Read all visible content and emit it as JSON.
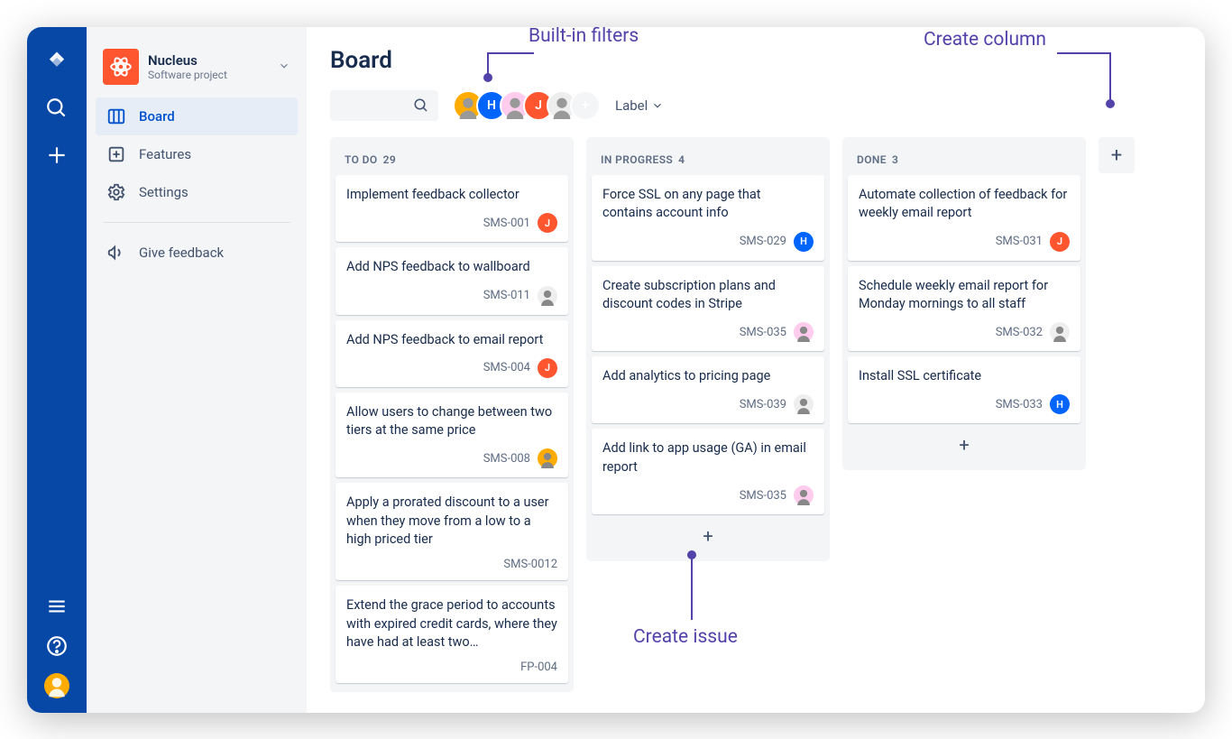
{
  "project": {
    "name": "Nucleus",
    "subtitle": "Software project"
  },
  "nav": {
    "board": "Board",
    "features": "Features",
    "settings": "Settings",
    "feedback": "Give feedback"
  },
  "page_title": "Board",
  "label_dropdown": "Label",
  "filter_avatars": [
    {
      "color_class": "av-orange",
      "letter": ""
    },
    {
      "color_class": "av-blue",
      "letter": "H"
    },
    {
      "color_class": "av-pink",
      "letter": ""
    },
    {
      "color_class": "av-red",
      "letter": "J"
    },
    {
      "color_class": "av-grey",
      "letter": ""
    }
  ],
  "columns": [
    {
      "name": "TO DO",
      "count": "29",
      "cards": [
        {
          "title": "Implement feedback collector",
          "key": "SMS-001",
          "avatar": {
            "type": "letter",
            "letter": "J",
            "color": "#FF5630"
          }
        },
        {
          "title": "Add NPS feedback to wallboard",
          "key": "SMS-011",
          "avatar": {
            "type": "photo",
            "bg": "#eee"
          }
        },
        {
          "title": "Add NPS feedback to email report",
          "key": "SMS-004",
          "avatar": {
            "type": "letter",
            "letter": "J",
            "color": "#FF5630"
          }
        },
        {
          "title": "Allow users to change between two tiers at the same price",
          "key": "SMS-008",
          "avatar": {
            "type": "photo",
            "bg": "#FFAB00"
          }
        },
        {
          "title": "Apply a prorated discount to a user when they move from a low to a high priced tier",
          "key": "SMS-0012",
          "avatar": null
        },
        {
          "title": "Extend the grace period to accounts with expired credit cards, where they have had at least two…",
          "key": "FP-004",
          "avatar": null
        }
      ]
    },
    {
      "name": "IN PROGRESS",
      "count": "4",
      "cards": [
        {
          "title": "Force SSL on any page that contains account info",
          "key": "SMS-029",
          "avatar": {
            "type": "letter",
            "letter": "H",
            "color": "#0065FF"
          }
        },
        {
          "title": "Create subscription plans and discount codes in Stripe",
          "key": "SMS-035",
          "avatar": {
            "type": "photo",
            "bg": "#fce"
          }
        },
        {
          "title": "Add analytics to pricing page",
          "key": "SMS-039",
          "avatar": {
            "type": "photo",
            "bg": "#eee"
          }
        },
        {
          "title": "Add link to app usage (GA) in email report",
          "key": "SMS-035",
          "avatar": {
            "type": "photo",
            "bg": "#fce"
          }
        }
      ]
    },
    {
      "name": "DONE",
      "count": "3",
      "cards": [
        {
          "title": "Automate collection of feedback for weekly email report",
          "key": "SMS-031",
          "avatar": {
            "type": "letter",
            "letter": "J",
            "color": "#FF5630"
          }
        },
        {
          "title": "Schedule weekly email report for Monday mornings to all staff",
          "key": "SMS-032",
          "avatar": {
            "type": "photo",
            "bg": "#eee"
          }
        },
        {
          "title": "Install SSL certificate",
          "key": "SMS-033",
          "avatar": {
            "type": "letter",
            "letter": "H",
            "color": "#0065FF"
          }
        }
      ]
    }
  ],
  "annotations": {
    "filters": "Built-in filters",
    "create_column": "Create column",
    "create_issue": "Create issue"
  }
}
